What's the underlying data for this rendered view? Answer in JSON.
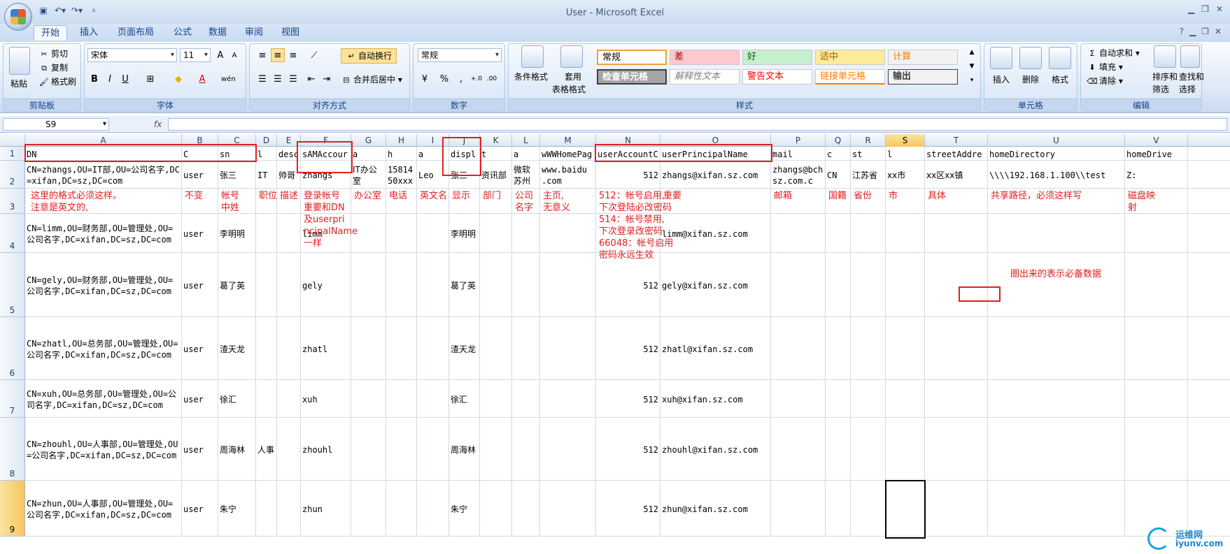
{
  "window": {
    "title": "User - Microsoft Excel"
  },
  "tabs": [
    "开始",
    "插入",
    "页面布局",
    "公式",
    "数据",
    "审阅",
    "视图"
  ],
  "ribbon": {
    "clipboard": {
      "label": "剪贴板",
      "paste": "粘贴",
      "cut": "剪切",
      "copy": "复制",
      "format_painter": "格式刷"
    },
    "font": {
      "label": "字体",
      "name": "宋体",
      "size": "11"
    },
    "alignment": {
      "label": "对齐方式",
      "wrap": "自动换行",
      "merge": "合并后居中"
    },
    "number": {
      "label": "数字",
      "format": "常规"
    },
    "styles": {
      "label": "样式",
      "conditional": "条件格式",
      "table": "套用",
      "table2": "表格格式",
      "cells": [
        {
          "text": "常规",
          "bg": "#ffffff",
          "fg": "#000000"
        },
        {
          "text": "差",
          "bg": "#ffc7ce",
          "fg": "#9c0006"
        },
        {
          "text": "好",
          "bg": "#c6efce",
          "fg": "#006100"
        },
        {
          "text": "适中",
          "bg": "#ffeb9c",
          "fg": "#9c6500"
        },
        {
          "text": "计算",
          "bg": "#f2f2f2",
          "fg": "#fa7d00"
        },
        {
          "text": "检查单元格",
          "bg": "#a5a5a5",
          "fg": "#ffffff"
        },
        {
          "text": "解释性文本",
          "bg": "#ffffff",
          "fg": "#7f7f7f"
        },
        {
          "text": "警告文本",
          "bg": "#ffffff",
          "fg": "#ff0000"
        },
        {
          "text": "链接单元格",
          "bg": "#ffffff",
          "fg": "#fa7d00"
        },
        {
          "text": "输出",
          "bg": "#f2f2f2",
          "fg": "#3f3f3f"
        }
      ]
    },
    "cells_group": {
      "label": "单元格",
      "insert": "插入",
      "delete": "删除",
      "format": "格式"
    },
    "editing": {
      "label": "编辑",
      "autosum": "自动求和",
      "fill": "填充",
      "clear": "清除",
      "sort": "排序和",
      "sort2": "筛选",
      "find": "查找和",
      "find2": "选择"
    }
  },
  "formula_bar": {
    "name_box": "S9",
    "fx": "fx",
    "value": ""
  },
  "columns": [
    "A",
    "B",
    "C",
    "D",
    "E",
    "F",
    "G",
    "H",
    "I",
    "J",
    "K",
    "L",
    "M",
    "N",
    "O",
    "P",
    "Q",
    "R",
    "S",
    "T",
    "U",
    "V"
  ],
  "rows": [
    "1",
    "2",
    "3",
    "4",
    "5",
    "6",
    "7",
    "8",
    "9"
  ],
  "cells": {
    "A1": "DN",
    "B1": "objectC",
    "C1": "sn",
    "D1": "titl",
    "E1": "desc",
    "F1": "sAMAccour",
    "G1": "physica",
    "H1": "teleph",
    "I1": "initia",
    "J1": "displ",
    "K1": "depart",
    "L1": "compa",
    "M1": "wWWHomePag",
    "N1": "userAccountC",
    "O1": "userPrincipalName",
    "P1": "mail",
    "Q1": "c",
    "R1": "st",
    "S1": "l",
    "T1": "streetAddre",
    "U1": "homeDirectory",
    "V1": "homeDrive",
    "A2": "CN=zhangs,OU=IT部,OU=公司名字,DC=xifan,DC=sz,DC=com",
    "B2": "user",
    "C2": "张三",
    "D2": "IT",
    "E2": "帅哥",
    "F2": "zhangs",
    "G2": "IT办公室",
    "H2": "15814 50xxx",
    "I2": "Leo",
    "J2": "张三",
    "K2": "资讯部",
    "L2": "微软苏州",
    "M2": "www.baidu .com",
    "N2": "512",
    "O2": "zhangs@xifan.sz.com",
    "P2": "zhangs@bchsz.com.c",
    "Q2": "CN",
    "R2": "江苏省",
    "S2": "xx市",
    "T2": "xx区xx镇",
    "U2": "\\\\\\\\192.168.1.100\\\\test",
    "V2": "Z:",
    "A4": "CN=limm,OU=财务部,OU=管理处,OU=公司名字,DC=xifan,DC=sz,DC=com",
    "B4": "user",
    "C4": "李明明",
    "F4": "limm",
    "J4": "李明明",
    "O4": "limm@xifan.sz.com",
    "A5": "CN=gely,OU=财务部,OU=管理处,OU=公司名字,DC=xifan,DC=sz,DC=com",
    "B5": "user",
    "C5": "葛了英",
    "F5": "gely",
    "J5": "葛了英",
    "N5": "512",
    "O5": "gely@xifan.sz.com",
    "A6": "CN=zhatl,OU=总务部,OU=管理处,OU=公司名字,DC=xifan,DC=sz,DC=com",
    "B6": "user",
    "C6": "渣天龙",
    "F6": "zhatl",
    "J6": "渣天龙",
    "N6": "512",
    "O6": "zhatl@xifan.sz.com",
    "A7": "CN=xuh,OU=总务部,OU=管理处,OU=公司名字,DC=xifan,DC=sz,DC=com",
    "B7": "user",
    "C7": "徐汇",
    "F7": "xuh",
    "J7": "徐汇",
    "N7": "512",
    "O7": "xuh@xifan.sz.com",
    "A8": "CN=zhouhl,OU=人事部,OU=管理处,OU=公司名字,DC=xifan,DC=sz,DC=com",
    "B8": "user",
    "C8": "周海林",
    "D8": "人事",
    "F8": "zhouhl",
    "J8": "周海林",
    "N8": "512",
    "O8": "zhouhl@xifan.sz.com",
    "A9": "CN=zhun,OU=人事部,OU=管理处,OU=公司名字,DC=xifan,DC=sz,DC=com",
    "B9": "user",
    "C9": "朱宁",
    "F9": "zhun",
    "J9": "朱宁",
    "N9": "512",
    "O9": "zhun@xifan.sz.com"
  },
  "notes": {
    "A3": "这里的格式必须这样。\n注意是英文的,",
    "B3": "不变",
    "C3": "帐号\n中姓",
    "D3": "职位",
    "E3": "描述",
    "F3": "登录帐号\n重要和DN\n及userpri\nncipalName\n一样",
    "G3": "办公室",
    "H3": "电话",
    "I3": "英文名",
    "J3": "显示",
    "K3": "部门",
    "L3": "公司\n名字",
    "M3": "主页,\n无意义",
    "N3": "512：帐号启用,\n下次登陆必改密码\n514：帐号禁用,\n下次登录改密码\n66048：帐号启用\n密码永远生效",
    "O3": "重要",
    "P3": "邮箱",
    "Q3": "国籍",
    "R3": "省份",
    "S3": "市",
    "T3": "具体",
    "U3": "共享路径，必须这样写",
    "V3": "磁盘映\n射",
    "legend": "圈出来的表示必备数据"
  },
  "watermark": {
    "line1": "运维网",
    "line2": "iyunv.com"
  }
}
